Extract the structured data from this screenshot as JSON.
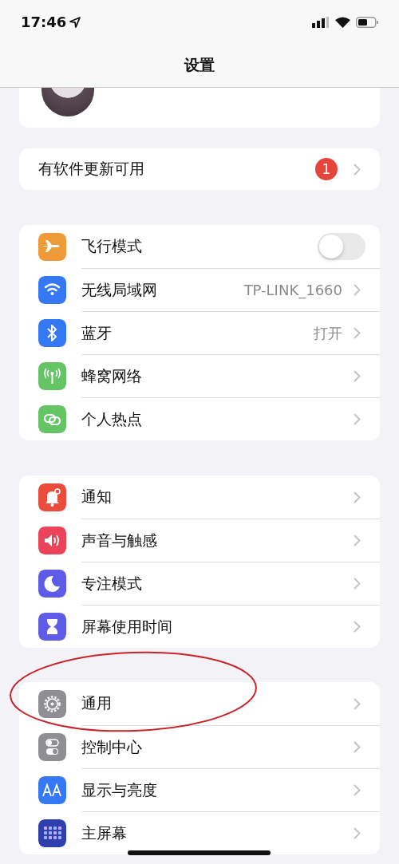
{
  "status_bar": {
    "time": "17:46"
  },
  "nav": {
    "title": "设置"
  },
  "update": {
    "label": "有软件更新可用",
    "badge": "1"
  },
  "groups": [
    [
      {
        "kind": "toggle",
        "label": "飞行模式",
        "on": false
      },
      {
        "kind": "link",
        "label": "无线局域网",
        "value": "TP-LINK_1660"
      },
      {
        "kind": "link",
        "label": "蓝牙",
        "value": "打开"
      },
      {
        "kind": "link",
        "label": "蜂窝网络"
      },
      {
        "kind": "link",
        "label": "个人热点"
      }
    ],
    [
      {
        "kind": "link",
        "label": "通知"
      },
      {
        "kind": "link",
        "label": "声音与触感"
      },
      {
        "kind": "link",
        "label": "专注模式"
      },
      {
        "kind": "link",
        "label": "屏幕使用时间"
      }
    ],
    [
      {
        "kind": "link",
        "label": "通用"
      },
      {
        "kind": "link",
        "label": "控制中心"
      },
      {
        "kind": "link",
        "label": "显示与亮度"
      },
      {
        "kind": "link",
        "label": "主屏幕"
      }
    ]
  ]
}
